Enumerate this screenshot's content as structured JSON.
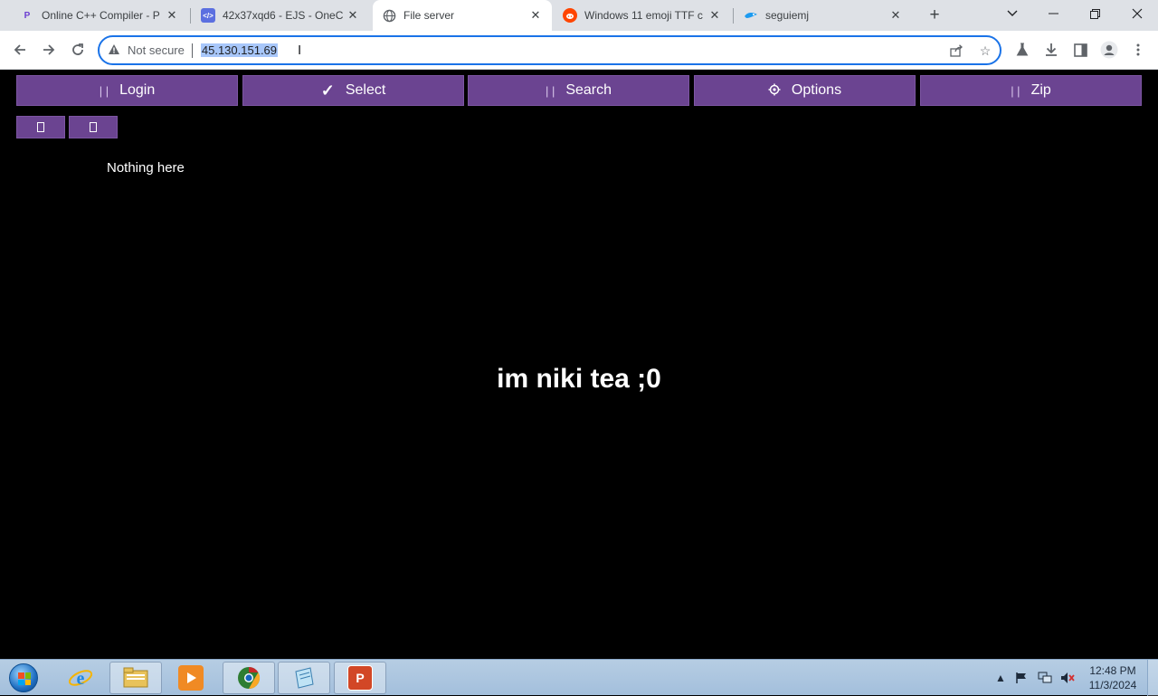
{
  "browser": {
    "tabs": [
      {
        "title": "Online C++ Compiler - P",
        "favicon": "P",
        "favicon_color": "#6c3fd1"
      },
      {
        "title": "42x37xqd6 - EJS - OneC",
        "favicon": "</>",
        "favicon_color": "#5b6fe0"
      },
      {
        "title": "File server",
        "favicon": "globe-icon",
        "favicon_color": "#5f6368"
      },
      {
        "title": "Windows 11 emoji TTF c",
        "favicon": "reddit-icon",
        "favicon_color": "#ff4500"
      },
      {
        "title": "seguiemj",
        "favicon": "bird-icon",
        "favicon_color": "#1d9bf0"
      }
    ],
    "active_tab_index": 2,
    "address_bar": {
      "security_label": "Not secure",
      "url": "45.130.151.69"
    }
  },
  "page": {
    "nav_buttons": [
      {
        "label": "Login",
        "icon": "placeholder-glyph-icon"
      },
      {
        "label": "Select",
        "icon": "check-icon"
      },
      {
        "label": "Search",
        "icon": "placeholder-glyph-icon"
      },
      {
        "label": "Options",
        "icon": "gear-icon"
      },
      {
        "label": "Zip",
        "icon": "placeholder-glyph-icon"
      }
    ],
    "empty_message": "Nothing here",
    "tagline": "im niki tea ;0",
    "accent_color": "#6b4491"
  },
  "taskbar": {
    "clock_time": "12:48 PM",
    "clock_date": "11/3/2024"
  }
}
